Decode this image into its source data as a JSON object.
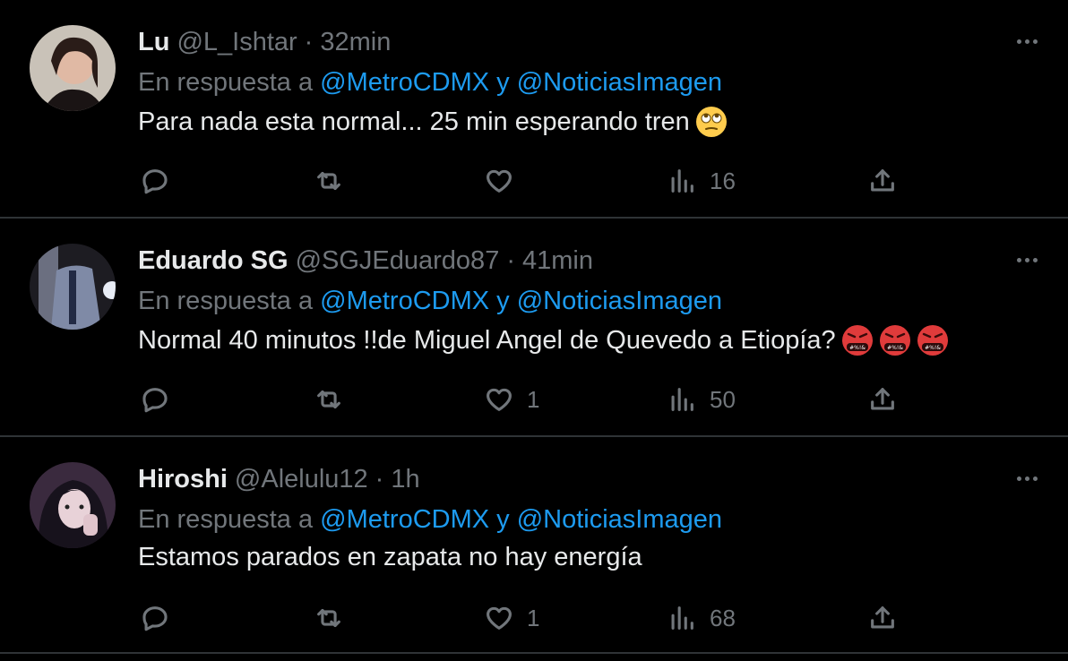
{
  "colors": {
    "background": "#000000",
    "text": "#e7e9ea",
    "muted": "#71767b",
    "link": "#1d9bf0",
    "divider": "#2f3336"
  },
  "tweets": [
    {
      "name": "Lu",
      "handle": "@L_Ishtar",
      "separator": "·",
      "time": "32min",
      "reply_prefix": "En respuesta a",
      "mention1": "@MetroCDMX",
      "reply_joiner": "y",
      "mention2": "@NoticiasImagen",
      "text": "Para nada esta normal... 25 min esperando tren",
      "emojis": [
        "face-with-rolling-eyes"
      ],
      "likes": "",
      "views": "16"
    },
    {
      "name": "Eduardo SG",
      "handle": "@SGJEduardo87",
      "separator": "·",
      "time": "41min",
      "reply_prefix": "En respuesta a",
      "mention1": "@MetroCDMX",
      "reply_joiner": "y",
      "mention2": "@NoticiasImagen",
      "text": "Normal 40 minutos !!de Miguel Angel de Quevedo a Etiopía?",
      "emojis": [
        "face-with-symbols-on-mouth",
        "face-with-symbols-on-mouth",
        "face-with-symbols-on-mouth"
      ],
      "likes": "1",
      "views": "50"
    },
    {
      "name": "Hiroshi",
      "handle": "@Alelulu12",
      "separator": "·",
      "time": "1h",
      "reply_prefix": "En respuesta a",
      "mention1": "@MetroCDMX",
      "reply_joiner": "y",
      "mention2": "@NoticiasImagen",
      "text": "Estamos parados en zapata no hay energía",
      "emojis": [],
      "likes": "1",
      "views": "68"
    }
  ]
}
